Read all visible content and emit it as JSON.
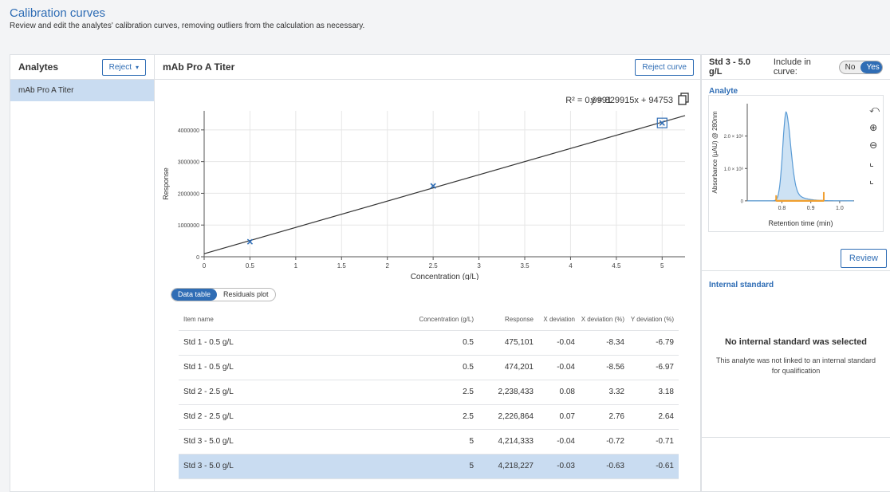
{
  "header": {
    "title": "Calibration curves",
    "subtitle": "Review and edit the analytes' calibration curves, removing outliers from the calculation as necessary."
  },
  "analytes": {
    "heading": "Analytes",
    "reject_label": "Reject",
    "items": [
      "mAb Pro A Titer"
    ]
  },
  "main": {
    "title": "mAb Pro A Titer",
    "reject_curve_label": "Reject curve",
    "r2_text": "R² = 0.9991",
    "equation_text": "y = 829915x + 94753",
    "tabs": [
      "Data table",
      "Residuals plot"
    ]
  },
  "chart_data": [
    {
      "type": "scatter",
      "title": "",
      "xlabel": "Concentration (g/L)",
      "ylabel": "Response",
      "xlim": [
        0,
        5.25
      ],
      "ylim": [
        0,
        4600000
      ],
      "x_ticks": [
        0,
        0.5,
        1,
        1.5,
        2,
        2.5,
        3,
        3.5,
        4,
        4.5,
        5
      ],
      "x_tick_labels": [
        "0",
        "0.5",
        "1",
        "1.5",
        "2",
        "2.5",
        "3",
        "3.5",
        "4",
        "4.5",
        "5"
      ],
      "y_ticks": [
        0,
        1000000,
        2000000,
        3000000,
        4000000
      ],
      "y_tick_labels": [
        "0",
        "1000000",
        "2000000",
        "3000000",
        "4000000"
      ],
      "grid": true,
      "points": [
        {
          "x": 0.5,
          "y": 475101
        },
        {
          "x": 0.5,
          "y": 474201
        },
        {
          "x": 2.5,
          "y": 2238433
        },
        {
          "x": 2.5,
          "y": 2226864
        },
        {
          "x": 5,
          "y": 4214333
        },
        {
          "x": 5,
          "y": 4218227
        }
      ],
      "selected_point_x": 5,
      "fit": {
        "slope": 829915,
        "intercept": 94753,
        "r2": 0.9991
      },
      "point_color": "#2f6db5",
      "line_color": "#333333"
    },
    {
      "type": "area",
      "title": "",
      "xlabel": "Retention time (min)",
      "ylabel": "Absorbance (µAU) @ 280nm",
      "xlim": [
        0.68,
        1.05
      ],
      "ylim": [
        -200000,
        3000000
      ],
      "x_ticks": [
        0.8,
        0.9,
        1.0
      ],
      "x_tick_labels": [
        "0.8",
        "0.9",
        "1.0"
      ],
      "y_ticks": [
        0,
        1000000,
        2000000
      ],
      "y_tick_labels": [
        "0",
        "1.0 × 10⁶",
        "2.0 × 10⁶"
      ],
      "peak_apex_x": 0.815,
      "peak_apex_y": 2750000,
      "integration_start_x": 0.78,
      "integration_end_x": 0.945,
      "fill_color": "#cde2f4",
      "line_color": "#5a9bd5",
      "integration_color": "#f0a030"
    }
  ],
  "table": {
    "columns": [
      "Item name",
      "Concentration (g/L)",
      "Response",
      "X deviation",
      "X deviation (%)",
      "Y deviation (%)"
    ],
    "rows": [
      [
        "Std 1 - 0.5 g/L",
        "0.5",
        "475,101",
        "-0.04",
        "-8.34",
        "-6.79"
      ],
      [
        "Std 1 - 0.5 g/L",
        "0.5",
        "474,201",
        "-0.04",
        "-8.56",
        "-6.97"
      ],
      [
        "Std 2 - 2.5 g/L",
        "2.5",
        "2,238,433",
        "0.08",
        "3.32",
        "3.18"
      ],
      [
        "Std 2 - 2.5 g/L",
        "2.5",
        "2,226,864",
        "0.07",
        "2.76",
        "2.64"
      ],
      [
        "Std 3 - 5.0 g/L",
        "5",
        "4,214,333",
        "-0.04",
        "-0.72",
        "-0.71"
      ],
      [
        "Std 3 - 5.0 g/L",
        "5",
        "4,218,227",
        "-0.03",
        "-0.63",
        "-0.61"
      ]
    ],
    "selected_row": 5
  },
  "right": {
    "std_label": "Std 3 - 5.0 g/L",
    "include_label": "Include in curve:",
    "no_label": "No",
    "yes_label": "Yes",
    "analyte_title": "Analyte",
    "review_label": "Review",
    "internal_standard_title": "Internal standard",
    "no_is_title": "No internal standard was selected",
    "no_is_desc": "This analyte was not linked to an internal standard for qualification"
  },
  "icons": {
    "reject_caret": "chevron-down-icon",
    "copy": "copy-icon",
    "zoom_reset": "zoom-reset-icon",
    "zoom_in": "zoom-in-icon",
    "zoom_out": "zoom-out-icon",
    "fit_axes": "fit-axes-icon",
    "expand_axes": "expand-axes-icon"
  }
}
